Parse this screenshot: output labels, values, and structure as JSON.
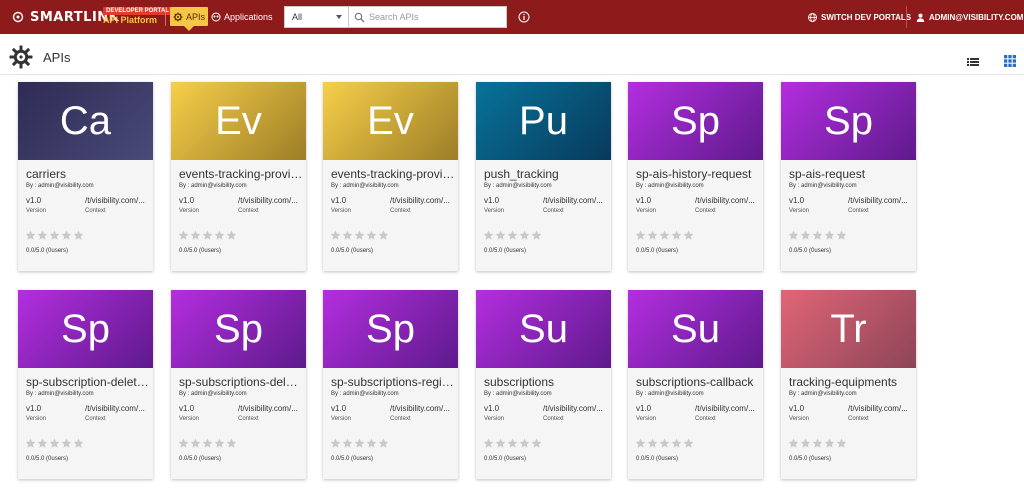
{
  "header": {
    "brand": "SMARTLINK",
    "portal_tag": "DEVELOPER PORTAL",
    "platform": "API Platform",
    "nav_apis": "APIs",
    "nav_applications": "Applications",
    "search_scope": "All",
    "search_placeholder": "Search APIs",
    "switch_label": "SWITCH DEV PORTALS",
    "user_label": "ADMIN@VISIBILITY.COM",
    "colors": {
      "bar": "#8e1b1b",
      "accent": "#f6c646"
    }
  },
  "page": {
    "title": "APIs"
  },
  "cards": [
    {
      "initials": "Ca",
      "name": "carriers",
      "by": "By : admin@visibility.com",
      "version": "v1.0",
      "version_label": "Version",
      "context": "/t/visibility.com/...",
      "context_label": "Context",
      "rating": "0.0/5.0 (0users)",
      "color_a": "#2e2c55",
      "color_b": "#4a4a78"
    },
    {
      "initials": "Ev",
      "name": "events-tracking-provid...",
      "by": "By : admin@visibility.com",
      "version": "v1.0",
      "version_label": "Version",
      "context": "/t/visibility.com/...",
      "context_label": "Context",
      "rating": "0.0/5.0 (0users)",
      "color_a": "#f7cf4a",
      "color_b": "#9c7e26"
    },
    {
      "initials": "Ev",
      "name": "events-tracking-provid...",
      "by": "By : admin@visibility.com",
      "version": "v1.0",
      "version_label": "Version",
      "context": "/t/visibility.com/...",
      "context_label": "Context",
      "rating": "0.0/5.0 (0users)",
      "color_a": "#f7cf4a",
      "color_b": "#9c7e26"
    },
    {
      "initials": "Pu",
      "name": "push_tracking",
      "by": "By : admin@visibility.com",
      "version": "v1.0",
      "version_label": "Version",
      "context": "/t/visibility.com/...",
      "context_label": "Context",
      "rating": "0.0/5.0 (0users)",
      "color_a": "#08739a",
      "color_b": "#073a5c"
    },
    {
      "initials": "Sp",
      "name": "sp-ais-history-request",
      "by": "By : admin@visibility.com",
      "version": "v1.0",
      "version_label": "Version",
      "context": "/t/visibility.com/...",
      "context_label": "Context",
      "rating": "0.0/5.0 (0users)",
      "color_a": "#b42ee0",
      "color_b": "#5e1a8c"
    },
    {
      "initials": "Sp",
      "name": "sp-ais-request",
      "by": "By : admin@visibility.com",
      "version": "v1.0",
      "version_label": "Version",
      "context": "/t/visibility.com/...",
      "context_label": "Context",
      "rating": "0.0/5.0 (0users)",
      "color_a": "#b42ee0",
      "color_b": "#5e1a8c"
    },
    {
      "initials": "Sp",
      "name": "sp-subscription-delete...",
      "by": "By : admin@visibility.com",
      "version": "v1.0",
      "version_label": "Version",
      "context": "/t/visibility.com/...",
      "context_label": "Context",
      "rating": "0.0/5.0 (0users)",
      "color_a": "#b42ee0",
      "color_b": "#5e1a8c"
    },
    {
      "initials": "Sp",
      "name": "sp-subscriptions-delet...",
      "by": "By : admin@visibility.com",
      "version": "v1.0",
      "version_label": "Version",
      "context": "/t/visibility.com/...",
      "context_label": "Context",
      "rating": "0.0/5.0 (0users)",
      "color_a": "#b42ee0",
      "color_b": "#5e1a8c"
    },
    {
      "initials": "Sp",
      "name": "sp-subscriptions-regis...",
      "by": "By : admin@visibility.com",
      "version": "v1.0",
      "version_label": "Version",
      "context": "/t/visibility.com/...",
      "context_label": "Context",
      "rating": "0.0/5.0 (0users)",
      "color_a": "#b42ee0",
      "color_b": "#5e1a8c"
    },
    {
      "initials": "Su",
      "name": "subscriptions",
      "by": "By : admin@visibility.com",
      "version": "v1.0",
      "version_label": "Version",
      "context": "/t/visibility.com/...",
      "context_label": "Context",
      "rating": "0.0/5.0 (0users)",
      "color_a": "#b42ee0",
      "color_b": "#5e1a8c"
    },
    {
      "initials": "Su",
      "name": "subscriptions-callback",
      "by": "By : admin@visibility.com",
      "version": "v1.0",
      "version_label": "Version",
      "context": "/t/visibility.com/...",
      "context_label": "Context",
      "rating": "0.0/5.0 (0users)",
      "color_a": "#b42ee0",
      "color_b": "#5e1a8c"
    },
    {
      "initials": "Tr",
      "name": "tracking-equipments",
      "by": "By : admin@visibility.com",
      "version": "v1.0",
      "version_label": "Version",
      "context": "/t/visibility.com/...",
      "context_label": "Context",
      "rating": "0.0/5.0 (0users)",
      "color_a": "#e06677",
      "color_b": "#8e4458"
    }
  ]
}
